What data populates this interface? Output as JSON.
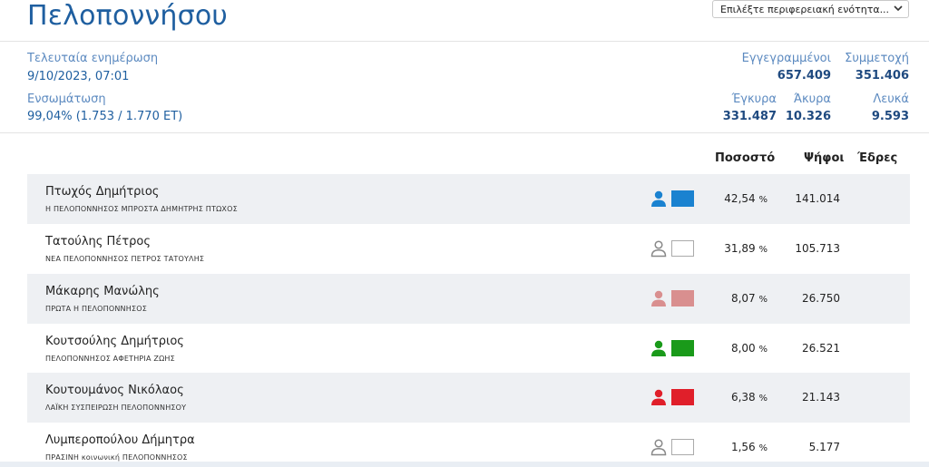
{
  "header": {
    "title": "Πελοποννήσου",
    "region_select_placeholder": "Επιλέξτε περιφερειακή ενότητα..."
  },
  "summary": {
    "last_update_label": "Τελευταία ενημέρωση",
    "last_update_value": "9/10/2023, 07:01",
    "integration_label": "Ενσωμάτωση",
    "integration_value": "99,04% (1.753 / 1.770 ΕΤ)",
    "registered_label": "Εγγεγραμμένοι",
    "registered_value": "657.409",
    "turnout_label": "Συμμετοχή",
    "turnout_value": "351.406",
    "valid_label": "Έγκυρα",
    "valid_value": "331.487",
    "invalid_label": "Άκυρα",
    "invalid_value": "10.326",
    "blank_label": "Λευκά",
    "blank_value": "9.593"
  },
  "table": {
    "col_percent": "Ποσοστό",
    "col_votes": "Ψήφοι",
    "col_seats": "Έδρες",
    "percent_unit": "%",
    "rows": [
      {
        "candidate": "Πτωχός Δημήτριος",
        "party": "Η ΠΕΛΟΠΟΝΝΗΣΟΣ ΜΠΡΟΣΤΑ ΔΗΜΗΤΡΗΣ ΠΤΩΧΟΣ",
        "percent": "42,54",
        "votes": "141.014",
        "color": "#1a82d0",
        "icon": "person-icon"
      },
      {
        "candidate": "Τατούλης Πέτρος",
        "party": "ΝΕΑ ΠΕΛΟΠΟΝΝΗΣΟΣ ΠΕΤΡΟΣ ΤΑΤΟΥΛΗΣ",
        "percent": "31,89",
        "votes": "105.713",
        "color": "#ffffff",
        "icon": "person-outline-icon"
      },
      {
        "candidate": "Μάκαρης Μανώλης",
        "party": "ΠΡΩΤΑ Η ΠΕΛΟΠΟΝΝΗΣΟΣ",
        "percent": "8,07",
        "votes": "26.750",
        "color": "#d98f8f",
        "icon": "person-icon"
      },
      {
        "candidate": "Κουτσούλης Δημήτριος",
        "party": "ΠΕΛΟΠΟΝΝΗΣΟΣ ΑΦΕΤΗΡΙΑ ΖΩΗΣ",
        "percent": "8,00",
        "votes": "26.521",
        "color": "#1a9a1a",
        "icon": "person-icon"
      },
      {
        "candidate": "Κουτουμάνος Νικόλαος",
        "party": "ΛΑΪΚΗ ΣΥΣΠΕΙΡΩΣΗ ΠΕΛΟΠΟΝΝΗΣΟΥ",
        "percent": "6,38",
        "votes": "21.143",
        "color": "#e01f2a",
        "icon": "person-icon"
      },
      {
        "candidate": "Λυμπεροπούλου Δήμητρα",
        "party": "ΠΡΑΣΙΝΗ κοινωνική ΠΕΛΟΠΟΝΝΗΣΟΣ",
        "percent": "1,56",
        "votes": "5.177",
        "color": "#ffffff",
        "icon": "person-outline-icon"
      }
    ]
  },
  "icons": {
    "region_select_chevron": "chevron-down-icon"
  }
}
